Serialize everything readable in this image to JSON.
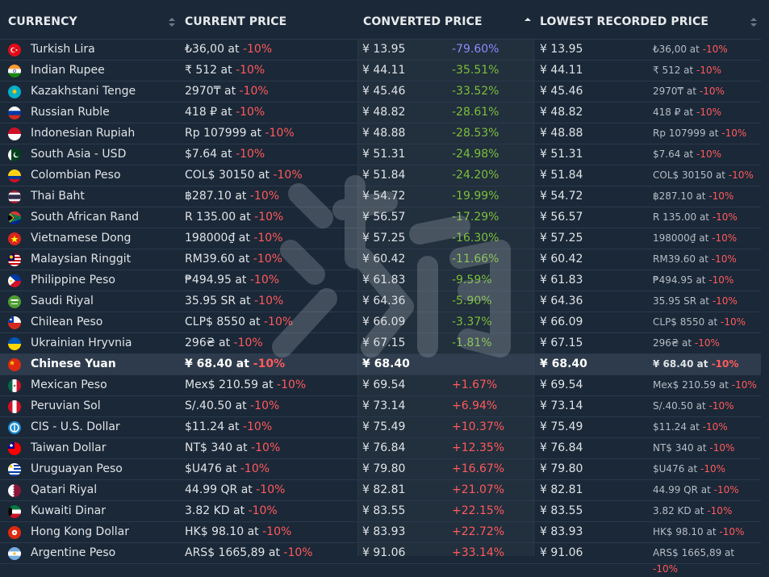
{
  "header": {
    "currency": "CURRENCY",
    "current_price": "CURRENT PRICE",
    "converted_price": "CONVERTED PRICE",
    "lowest_recorded_price": "LOWEST RECORDED PRICE"
  },
  "colors": {
    "background": "#1b2838",
    "discount_red": "#ff5a5a",
    "negative_green": "#7bbf3a",
    "best_blue": "#8a8cff"
  },
  "rows": [
    {
      "flag": "turkey-flag-icon",
      "currency": "Turkish Lira",
      "price": "₺36,00 at ",
      "disc": "-10%",
      "conv": "¥ 13.95",
      "pct": "-79.60%",
      "low": "¥ 13.95",
      "low_price": "₺36,00 at ",
      "low_disc": "-10%"
    },
    {
      "flag": "india-flag-icon",
      "currency": "Indian Rupee",
      "price": "₹ 512 at ",
      "disc": "-10%",
      "conv": "¥ 44.11",
      "pct": "-35.51%",
      "low": "¥ 44.11",
      "low_price": "₹ 512 at ",
      "low_disc": "-10%"
    },
    {
      "flag": "kazakhstan-flag-icon",
      "currency": "Kazakhstani Tenge",
      "price": "2970₸ at ",
      "disc": "-10%",
      "conv": "¥ 45.46",
      "pct": "-33.52%",
      "low": "¥ 45.46",
      "low_price": "2970₸ at ",
      "low_disc": "-10%"
    },
    {
      "flag": "russia-flag-icon",
      "currency": "Russian Ruble",
      "price": "418 ₽ at ",
      "disc": "-10%",
      "conv": "¥ 48.82",
      "pct": "-28.61%",
      "low": "¥ 48.82",
      "low_price": "418 ₽ at ",
      "low_disc": "-10%"
    },
    {
      "flag": "indonesia-flag-icon",
      "currency": "Indonesian Rupiah",
      "price": "Rp 107999 at ",
      "disc": "-10%",
      "conv": "¥ 48.88",
      "pct": "-28.53%",
      "low": "¥ 48.88",
      "low_price": "Rp 107999 at ",
      "low_disc": "-10%"
    },
    {
      "flag": "pakistan-flag-icon",
      "currency": "South Asia - USD",
      "price": "$7.64 at ",
      "disc": "-10%",
      "conv": "¥ 51.31",
      "pct": "-24.98%",
      "low": "¥ 51.31",
      "low_price": "$7.64 at ",
      "low_disc": "-10%"
    },
    {
      "flag": "colombia-flag-icon",
      "currency": "Colombian Peso",
      "price": "COL$ 30150 at ",
      "disc": "-10%",
      "conv": "¥ 51.84",
      "pct": "-24.20%",
      "low": "¥ 51.84",
      "low_price": "COL$ 30150 at ",
      "low_disc": "-10%"
    },
    {
      "flag": "thailand-flag-icon",
      "currency": "Thai Baht",
      "price": "฿287.10 at ",
      "disc": "-10%",
      "conv": "¥ 54.72",
      "pct": "-19.99%",
      "low": "¥ 54.72",
      "low_price": "฿287.10 at ",
      "low_disc": "-10%"
    },
    {
      "flag": "south-africa-flag-icon",
      "currency": "South African Rand",
      "price": "R 135.00 at ",
      "disc": "-10%",
      "conv": "¥ 56.57",
      "pct": "-17.29%",
      "low": "¥ 56.57",
      "low_price": "R 135.00 at ",
      "low_disc": "-10%"
    },
    {
      "flag": "vietnam-flag-icon",
      "currency": "Vietnamese Dong",
      "price": "198000₫ at ",
      "disc": "-10%",
      "conv": "¥ 57.25",
      "pct": "-16.30%",
      "low": "¥ 57.25",
      "low_price": "198000₫ at ",
      "low_disc": "-10%"
    },
    {
      "flag": "malaysia-flag-icon",
      "currency": "Malaysian Ringgit",
      "price": "RM39.60 at ",
      "disc": "-10%",
      "conv": "¥ 60.42",
      "pct": "-11.66%",
      "low": "¥ 60.42",
      "low_price": "RM39.60 at ",
      "low_disc": "-10%"
    },
    {
      "flag": "philippines-flag-icon",
      "currency": "Philippine Peso",
      "price": "₱494.95 at ",
      "disc": "-10%",
      "conv": "¥ 61.83",
      "pct": "-9.59%",
      "low": "¥ 61.83",
      "low_price": "₱494.95 at ",
      "low_disc": "-10%"
    },
    {
      "flag": "saudi-arabia-flag-icon",
      "currency": "Saudi Riyal",
      "price": "35.95 SR at ",
      "disc": "-10%",
      "conv": "¥ 64.36",
      "pct": "-5.90%",
      "low": "¥ 64.36",
      "low_price": "35.95 SR at ",
      "low_disc": "-10%"
    },
    {
      "flag": "chile-flag-icon",
      "currency": "Chilean Peso",
      "price": "CLP$ 8550 at ",
      "disc": "-10%",
      "conv": "¥ 66.09",
      "pct": "-3.37%",
      "low": "¥ 66.09",
      "low_price": "CLP$ 8550 at ",
      "low_disc": "-10%"
    },
    {
      "flag": "ukraine-flag-icon",
      "currency": "Ukrainian Hryvnia",
      "price": "296₴ at ",
      "disc": "-10%",
      "conv": "¥ 67.15",
      "pct": "-1.81%",
      "low": "¥ 67.15",
      "low_price": "296₴ at ",
      "low_disc": "-10%"
    },
    {
      "flag": "china-flag-icon",
      "currency": "Chinese Yuan",
      "price": "¥ 68.40 at ",
      "disc": "-10%",
      "conv": "¥ 68.40",
      "pct": "",
      "low": "¥ 68.40",
      "low_price": "¥ 68.40 at ",
      "low_disc": "-10%",
      "highlight": true
    },
    {
      "flag": "mexico-flag-icon",
      "currency": "Mexican Peso",
      "price": "Mex$ 210.59 at ",
      "disc": "-10%",
      "conv": "¥ 69.54",
      "pct": "+1.67%",
      "low": "¥ 69.54",
      "low_price": "Mex$ 210.59 at ",
      "low_disc": "-10%"
    },
    {
      "flag": "peru-flag-icon",
      "currency": "Peruvian Sol",
      "price": "S/.40.50 at ",
      "disc": "-10%",
      "conv": "¥ 73.14",
      "pct": "+6.94%",
      "low": "¥ 73.14",
      "low_price": "S/.40.50 at ",
      "low_disc": "-10%"
    },
    {
      "flag": "cis-flag-icon",
      "currency": "CIS - U.S. Dollar",
      "price": "$11.24 at ",
      "disc": "-10%",
      "conv": "¥ 75.49",
      "pct": "+10.37%",
      "low": "¥ 75.49",
      "low_price": "$11.24 at ",
      "low_disc": "-10%"
    },
    {
      "flag": "taiwan-flag-icon",
      "currency": "Taiwan Dollar",
      "price": "NT$ 340 at ",
      "disc": "-10%",
      "conv": "¥ 76.84",
      "pct": "+12.35%",
      "low": "¥ 76.84",
      "low_price": "NT$ 340 at ",
      "low_disc": "-10%"
    },
    {
      "flag": "uruguay-flag-icon",
      "currency": "Uruguayan Peso",
      "price": "$U476 at ",
      "disc": "-10%",
      "conv": "¥ 79.80",
      "pct": "+16.67%",
      "low": "¥ 79.80",
      "low_price": "$U476 at ",
      "low_disc": "-10%"
    },
    {
      "flag": "qatar-flag-icon",
      "currency": "Qatari Riyal",
      "price": "44.99 QR at ",
      "disc": "-10%",
      "conv": "¥ 82.81",
      "pct": "+21.07%",
      "low": "¥ 82.81",
      "low_price": "44.99 QR at ",
      "low_disc": "-10%"
    },
    {
      "flag": "kuwait-flag-icon",
      "currency": "Kuwaiti Dinar",
      "price": "3.82 KD at ",
      "disc": "-10%",
      "conv": "¥ 83.55",
      "pct": "+22.15%",
      "low": "¥ 83.55",
      "low_price": "3.82 KD at ",
      "low_disc": "-10%"
    },
    {
      "flag": "hong-kong-flag-icon",
      "currency": "Hong Kong Dollar",
      "price": "HK$ 98.10 at ",
      "disc": "-10%",
      "conv": "¥ 83.93",
      "pct": "+22.72%",
      "low": "¥ 83.93",
      "low_price": "HK$ 98.10 at ",
      "low_disc": "-10%"
    },
    {
      "flag": "argentina-flag-icon",
      "currency": "Argentine Peso",
      "price": "ARS$ 1665,89 at ",
      "disc": "-10%",
      "conv": "¥ 91.06",
      "pct": "+33.14%",
      "low": "¥ 91.06",
      "low_price": "ARS$ 1665,89 at ",
      "low_disc": "-10%"
    }
  ]
}
